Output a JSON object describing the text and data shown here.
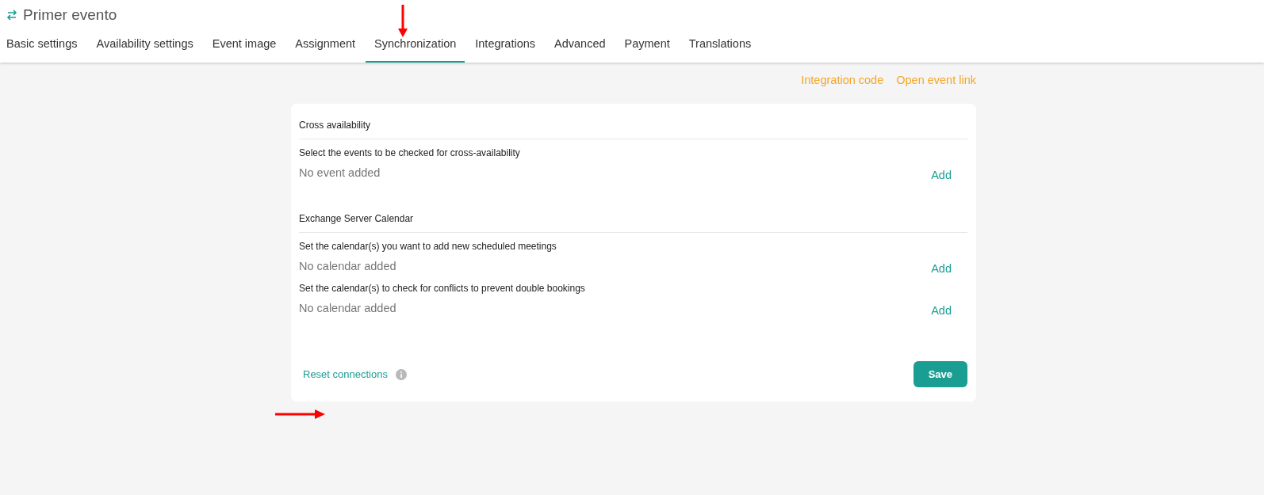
{
  "title": "Primer evento",
  "tabs": [
    {
      "label": "Basic settings",
      "selected": false
    },
    {
      "label": "Availability settings",
      "selected": false
    },
    {
      "label": "Event image",
      "selected": false
    },
    {
      "label": "Assignment",
      "selected": false
    },
    {
      "label": "Synchronization",
      "selected": true
    },
    {
      "label": "Integrations",
      "selected": false
    },
    {
      "label": "Advanced",
      "selected": false
    },
    {
      "label": "Payment",
      "selected": false
    },
    {
      "label": "Translations",
      "selected": false
    }
  ],
  "top_links": [
    "Integration code",
    "Open event link"
  ],
  "sections": [
    {
      "heading": "Cross availability",
      "fields": [
        {
          "label": "Select the events to be checked for cross-availability",
          "empty_text": "No event added",
          "action": "Add"
        }
      ]
    },
    {
      "heading": "Exchange Server Calendar",
      "fields": [
        {
          "label": "Set the calendar(s) you want to add new scheduled meetings",
          "empty_text": "No calendar added",
          "action": "Add"
        },
        {
          "label": "Set the calendar(s) to check for conflicts to prevent double bookings",
          "empty_text": "No calendar added",
          "action": "Add"
        }
      ]
    }
  ],
  "reset_link": "Reset connections",
  "save_button": "Save"
}
